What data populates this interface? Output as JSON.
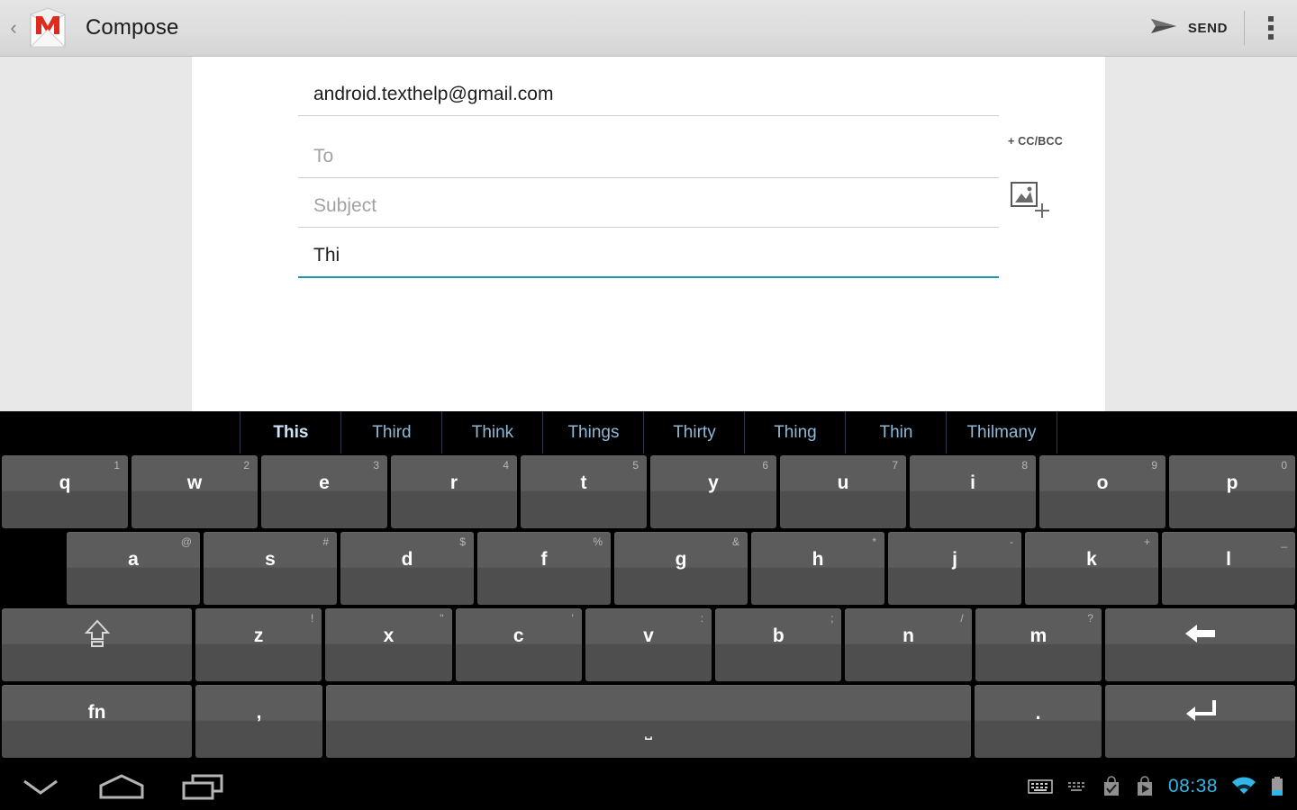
{
  "appbar": {
    "up_icon": "up-chevron-icon",
    "app_icon": "gmail-envelope-icon",
    "title": "Compose",
    "send_icon": "send-paper-plane-icon",
    "send_label": "SEND",
    "overflow_icon": "overflow-menu-icon"
  },
  "compose": {
    "from_value": "android.texthelp@gmail.com",
    "to_placeholder": "To",
    "subject_placeholder": "Subject",
    "body_value": "Thi",
    "ccbcc_label": "+ CC/BCC",
    "attach_icon": "add-image-attachment-icon",
    "focus_color": "#2196a8"
  },
  "keyboard": {
    "suggestions": [
      {
        "word": "This",
        "active": true
      },
      {
        "word": "Third",
        "active": false
      },
      {
        "word": "Think",
        "active": false
      },
      {
        "word": "Things",
        "active": false
      },
      {
        "word": "Thirty",
        "active": false
      },
      {
        "word": "Thing",
        "active": false
      },
      {
        "word": "Thin",
        "active": false
      },
      {
        "word": "Thilmany",
        "active": false
      }
    ],
    "row1": [
      {
        "key": "q",
        "hint": "1"
      },
      {
        "key": "w",
        "hint": "2"
      },
      {
        "key": "e",
        "hint": "3"
      },
      {
        "key": "r",
        "hint": "4"
      },
      {
        "key": "t",
        "hint": "5"
      },
      {
        "key": "y",
        "hint": "6"
      },
      {
        "key": "u",
        "hint": "7"
      },
      {
        "key": "i",
        "hint": "8"
      },
      {
        "key": "o",
        "hint": "9"
      },
      {
        "key": "p",
        "hint": "0"
      }
    ],
    "row2": [
      {
        "key": "a",
        "hint": "@"
      },
      {
        "key": "s",
        "hint": "#"
      },
      {
        "key": "d",
        "hint": "$"
      },
      {
        "key": "f",
        "hint": "%"
      },
      {
        "key": "g",
        "hint": "&"
      },
      {
        "key": "h",
        "hint": "*"
      },
      {
        "key": "j",
        "hint": "-"
      },
      {
        "key": "k",
        "hint": "+"
      },
      {
        "key": "l",
        "hint": "_"
      }
    ],
    "row3": [
      {
        "key": "z",
        "hint": "!"
      },
      {
        "key": "x",
        "hint": "\""
      },
      {
        "key": "c",
        "hint": "'"
      },
      {
        "key": "v",
        "hint": ":"
      },
      {
        "key": "b",
        "hint": ";"
      },
      {
        "key": "n",
        "hint": "/"
      },
      {
        "key": "m",
        "hint": "?"
      }
    ],
    "shift_icon": "shift-arrow-icon",
    "backspace_icon": "backspace-arrow-icon",
    "fn_label": "fn",
    "comma_label": ",",
    "space_label": "⎵",
    "period_label": ".",
    "enter_icon": "enter-return-icon"
  },
  "navbar": {
    "back_icon": "back-chevron-down-icon",
    "home_icon": "home-icon",
    "recents_icon": "recent-apps-icon",
    "tray": {
      "keyboard_icon": "keyboard-icon",
      "keyboard_alt_icon": "keyboard-alt-icon",
      "check_bag_icon": "checked-bag-icon",
      "play_bag_icon": "play-store-bag-icon",
      "clock": "08:38",
      "wifi_icon": "wifi-icon",
      "battery_icon": "battery-icon",
      "accent_color": "#33b5e5"
    }
  }
}
